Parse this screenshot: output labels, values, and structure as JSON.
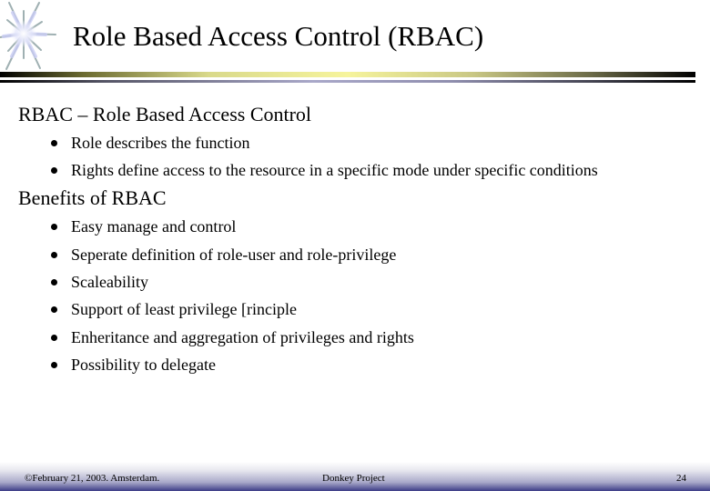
{
  "slide": {
    "title": "Role Based Access Control (RBAC)",
    "sections": [
      {
        "heading": "RBAC – Role Based Access Control",
        "bullets": [
          "Role describes the function",
          "Rights define access to the resource in a specific mode under specific conditions"
        ]
      },
      {
        "heading": "Benefits of RBAC",
        "bullets": [
          "Easy manage and control",
          "Seperate definition of role-user and role-privilege",
          "Scaleability",
          "Support of least privilege [rinciple",
          "Enheritance and aggregation of privileges and rights",
          "Possibility to delegate"
        ]
      }
    ],
    "footer": {
      "left": "©February 21, 2003. Amsterdam.",
      "center": "Donkey Project",
      "page_number": "24"
    },
    "icons": {
      "logo": "sparkle-star-icon",
      "bullet": "filled-circle-bullet"
    },
    "colors": {
      "title_rule_highlight": "#f6f49c",
      "subrule_highlight": "#a9a8c9",
      "footer_band": "#3c3c86"
    }
  }
}
